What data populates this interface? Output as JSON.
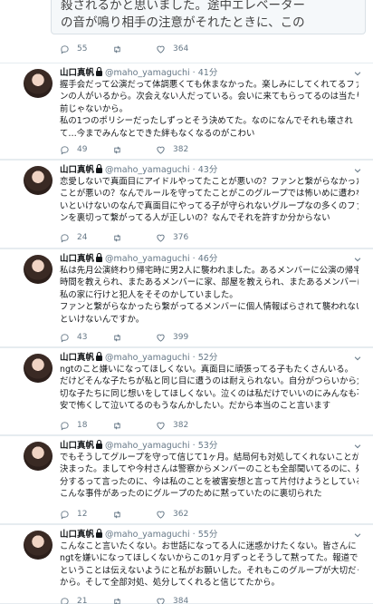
{
  "top_card": {
    "image_lines": [
      "殺されるかと思いました。途中エレベーター",
      "の音が鳴り相手の注意がそれたときに、この"
    ],
    "replies": "55",
    "likes": "364"
  },
  "icons": {
    "reply": "reply-icon",
    "retweet": "retweet-icon",
    "like": "heart-icon",
    "more": "chevron-down-icon",
    "protected": "lock-icon"
  },
  "tweets": [
    {
      "name": "山口真帆",
      "handle": "@maho_yamaguchi",
      "dot": "·",
      "time": "41分",
      "lines": [
        "握手会だって公演だって体調悪くても休まなかった。楽しみにしてくれてるファ",
        "ンの人がいるから。次会えない人だっている。会いに来てもらってるのは当たり",
        "前じゃないから。",
        "私の1つのポリシーだったしずっとそう決めてた。なのになんでそれも壊され",
        "て…今までみんなとできた絆もなくなるのがこわい"
      ],
      "replies": "49",
      "likes": "382"
    },
    {
      "name": "山口真帆",
      "handle": "@maho_yamaguchi",
      "dot": "·",
      "time": "43分",
      "lines": [
        "恋愛しないで真面目にアイドルやってたことが悪いの？ファンと繋がらなかった",
        "ことが悪いの？なんでルールを守ってたことがこのグループでは怖いめに遭わな",
        "いといけないのなんで真面目にやってる子が守られないグループなの多くのファ",
        "ンを裏切って繋がってる人が正しいの？なんでそれを許すか分からない"
      ],
      "replies": "24",
      "likes": "376"
    },
    {
      "name": "山口真帆",
      "handle": "@maho_yamaguchi",
      "dot": "·",
      "time": "46分",
      "lines": [
        "私は先月公演終わり帰宅時に男2人に襲われました。あるメンバーに公演の帰宅",
        "時間を教えられ、またあるメンバーに家、部屋を教えられ、またあるメンバーは",
        "私の家に行けと犯人をそそのかしていました。",
        "ファンと繋がらなかったら繋がってるメンバーに個人情報ばらされて襲われない",
        "といけないんですか。"
      ],
      "replies": "43",
      "likes": "399"
    },
    {
      "name": "山口真帆",
      "handle": "@maho_yamaguchi",
      "dot": "·",
      "time": "52分",
      "lines": [
        "ngtのこと嫌いになってほしくない。真面目に頑張ってる子もたくさんいる。",
        "だけどそんな子たちが私と同じ目に遭うのは耐えられない。自分がつらいから大",
        "切な子たちに同じ想いをしてほしくない。泣くのは私だけでいいのにみんなも不",
        "安で怖くして泣いてるのもうなんかしたい。だから本当のこと言います"
      ],
      "replies": "18",
      "likes": "382"
    },
    {
      "name": "山口真帆",
      "handle": "@maho_yamaguchi",
      "dot": "·",
      "time": "53分",
      "lines": [
        "でもそうしてグループを守って信じて1ヶ月。結局何も対処してくれないことが",
        "決まった。ましてや今村さんは警察からメンバーのことも全部聞いてるのに、処",
        "分するって言ったのに、今は私のことを被害妄想と言って片付けようとしている。",
        "こんな事件があったのにグループのために黙っていたのに裏切られた"
      ],
      "replies": "12",
      "likes": "362"
    },
    {
      "name": "山口真帆",
      "handle": "@maho_yamaguchi",
      "dot": "·",
      "time": "55分",
      "lines": [
        "こんなこと言いたくない。お世話になってる人に迷惑かけたくない。皆さんに",
        "ngtを嫌いになってほしくないからこの1ヶ月ずっとそうして黙ってた。報道でもngt",
        "ということは伝えないようにと私がお願いした。それもこのグループが大切だった",
        "から。そして全部対処、処分してくれると信じてたから。"
      ],
      "replies": "21",
      "likes": "384"
    }
  ]
}
